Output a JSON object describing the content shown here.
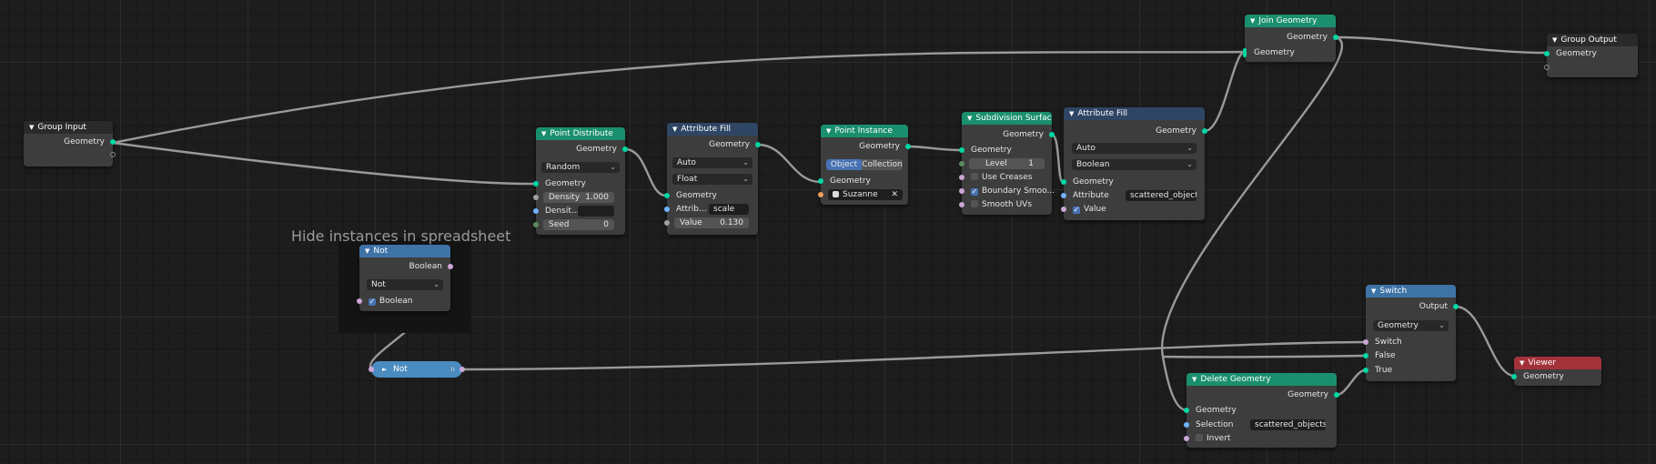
{
  "frame": {
    "label": "Hide instances in spreadsheet"
  },
  "nodes": {
    "group_input": {
      "title": "Group Input",
      "out_geometry": "Geometry"
    },
    "point_distribute": {
      "title": "Point Distribute",
      "out_geometry": "Geometry",
      "mode": "Random",
      "in_geometry": "Geometry",
      "density_label": "Density",
      "density_value": "1.000",
      "density_attr_label": "Densit...",
      "seed_label": "Seed",
      "seed_value": "0"
    },
    "attribute_fill_1": {
      "title": "Attribute Fill",
      "out_geometry": "Geometry",
      "domain": "Auto",
      "type": "Float",
      "in_geometry": "Geometry",
      "attribute_label": "Attrib...",
      "attribute_value": "scale",
      "value_label": "Value",
      "value_value": "0.130"
    },
    "point_instance": {
      "title": "Point Instance",
      "out_geometry": "Geometry",
      "tab_object": "Object",
      "tab_collection": "Collection",
      "in_geometry": "Geometry",
      "object_value": "Suzanne"
    },
    "subdivision_surface": {
      "title": "Subdivision Surface",
      "out_geometry": "Geometry",
      "in_geometry": "Geometry",
      "level_label": "Level",
      "level_value": "1",
      "use_creases": "Use Creases",
      "boundary_smooth": "Boundary Smoo...",
      "smooth_uvs": "Smooth UVs"
    },
    "attribute_fill_2": {
      "title": "Attribute Fill",
      "out_geometry": "Geometry",
      "domain": "Auto",
      "type": "Boolean",
      "in_geometry": "Geometry",
      "attribute_label": "Attribute",
      "attribute_value": "scattered_objects",
      "value_label": "Value"
    },
    "join_geometry": {
      "title": "Join Geometry",
      "out_geometry": "Geometry",
      "in_geometry": "Geometry"
    },
    "group_output": {
      "title": "Group Output",
      "in_geometry": "Geometry"
    },
    "not_node": {
      "title": "Not",
      "out_boolean": "Boolean",
      "operation": "Not",
      "in_boolean": "Boolean"
    },
    "not_collapsed": {
      "title": "Not"
    },
    "switch": {
      "title": "Switch",
      "out_output": "Output",
      "type": "Geometry",
      "in_switch": "Switch",
      "in_false": "False",
      "in_true": "True"
    },
    "delete_geometry": {
      "title": "Delete Geometry",
      "out_geometry": "Geometry",
      "in_geometry": "Geometry",
      "selection_label": "Selection",
      "selection_value": "scattered_objects",
      "invert": "Invert"
    },
    "viewer": {
      "title": "Viewer",
      "in_geometry": "Geometry"
    }
  },
  "colors": {
    "geometry_header": "#1a8f6e",
    "attribute_header": "#2f4564",
    "math_header": "#3e73a6",
    "viewer_header": "#a3313a",
    "geometry_socket": "#00d6a3",
    "link": "#9a9a9a"
  }
}
